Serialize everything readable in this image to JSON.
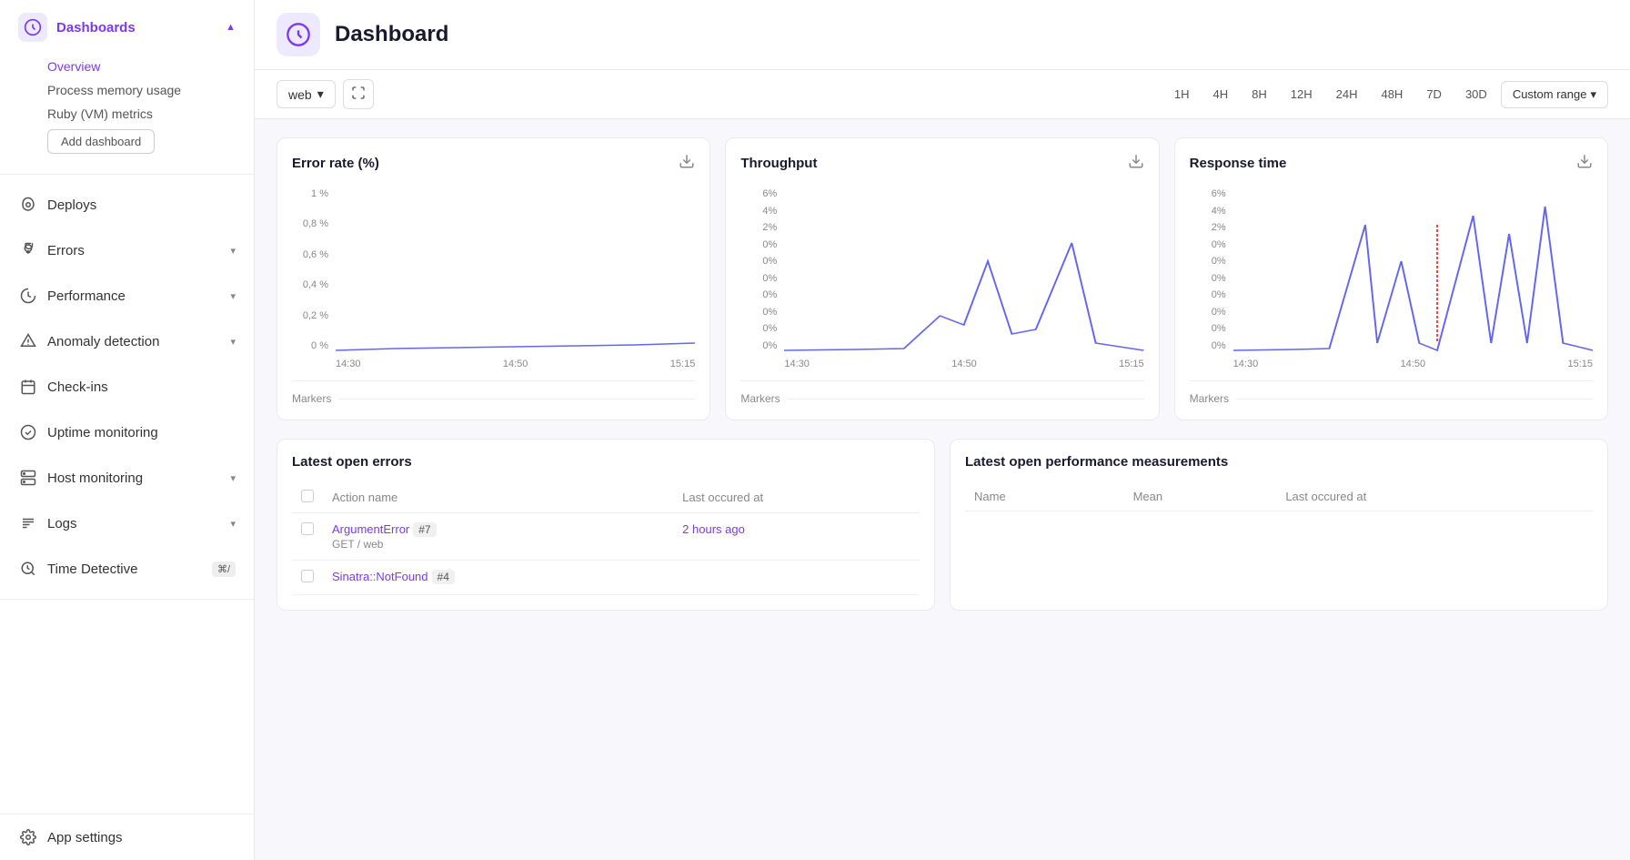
{
  "sidebar": {
    "dashboards": {
      "label": "Dashboards",
      "icon": "dashboard-icon",
      "sub_items": [
        {
          "label": "Overview",
          "active": true
        },
        {
          "label": "Process memory usage"
        },
        {
          "label": "Ruby (VM) metrics"
        }
      ],
      "add_button": "Add dashboard"
    },
    "nav_items": [
      {
        "id": "deploys",
        "label": "Deploys",
        "icon": "rocket-icon",
        "expandable": false
      },
      {
        "id": "errors",
        "label": "Errors",
        "icon": "bug-icon",
        "expandable": true
      },
      {
        "id": "performance",
        "label": "Performance",
        "icon": "gauge-icon",
        "expandable": true
      },
      {
        "id": "anomaly",
        "label": "Anomaly detection",
        "icon": "anomaly-icon",
        "expandable": true
      },
      {
        "id": "checkins",
        "label": "Check-ins",
        "icon": "checkin-icon",
        "expandable": false
      },
      {
        "id": "uptime",
        "label": "Uptime monitoring",
        "icon": "uptime-icon",
        "expandable": false
      },
      {
        "id": "host",
        "label": "Host monitoring",
        "icon": "server-icon",
        "expandable": true
      },
      {
        "id": "logs",
        "label": "Logs",
        "icon": "logs-icon",
        "expandable": true
      },
      {
        "id": "timedetective",
        "label": "Time Detective",
        "icon": "time-icon",
        "expandable": false,
        "kbd": "⌘/"
      }
    ],
    "bottom_item": {
      "label": "App settings",
      "icon": "settings-icon"
    }
  },
  "topbar": {
    "title": "Dashboard",
    "icon": "speedometer-icon"
  },
  "toolbar": {
    "dropdown_label": "web",
    "time_buttons": [
      "1H",
      "4H",
      "8H",
      "12H",
      "24H",
      "48H",
      "7D",
      "30D"
    ],
    "custom_range_label": "Custom range"
  },
  "error_rate_chart": {
    "title": "Error rate (%)",
    "y_labels": [
      "1 %",
      "0,8 %",
      "0,6 %",
      "0,4 %",
      "0,2 %",
      "0 %"
    ],
    "x_labels": [
      "14:30",
      "14:50",
      "15:15"
    ],
    "markers_label": "Markers"
  },
  "throughput_chart": {
    "title": "Throughput",
    "y_labels": [
      "6%",
      "4%",
      "2%",
      "0%",
      "0%",
      "0%",
      "0%",
      "0%",
      "0%",
      "0%"
    ],
    "x_labels": [
      "14:30",
      "14:50",
      "15:15"
    ],
    "markers_label": "Markers"
  },
  "response_time_chart": {
    "title": "Response time",
    "y_labels": [
      "6%",
      "4%",
      "2%",
      "0%",
      "0%",
      "0%",
      "0%",
      "0%",
      "0%",
      "0%"
    ],
    "x_labels": [
      "14:30",
      "14:50",
      "15:15"
    ],
    "markers_label": "Markers"
  },
  "errors_table": {
    "title": "Latest open errors",
    "columns": [
      "Action name",
      "Last occured at"
    ],
    "rows": [
      {
        "name": "ArgumentError",
        "badge": "#7",
        "sub": "GET /  web",
        "time": "2 hours ago"
      },
      {
        "name": "Sinatra::NotFound",
        "badge": "#4",
        "sub": "",
        "time": ""
      }
    ]
  },
  "perf_table": {
    "title": "Latest open performance measurements",
    "columns": [
      "Name",
      "Mean",
      "Last occured at"
    ]
  }
}
